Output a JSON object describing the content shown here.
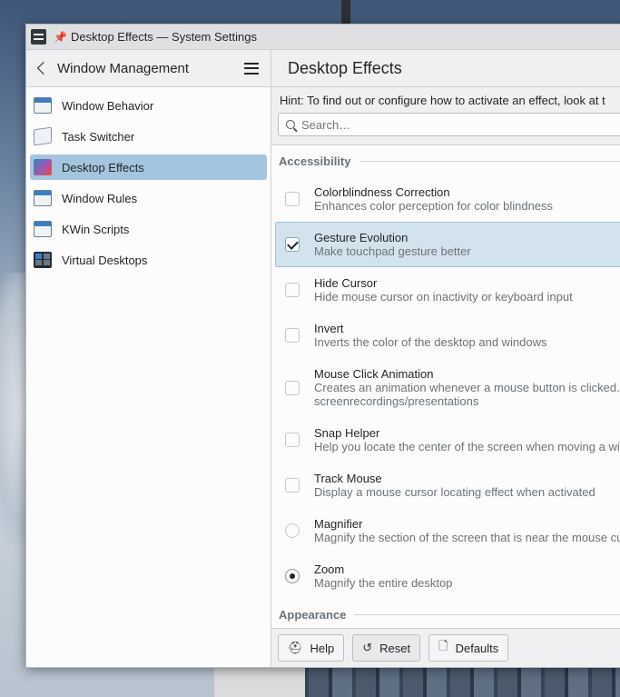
{
  "window": {
    "title": "Desktop Effects — System Settings"
  },
  "sidebar": {
    "header": "Window Management",
    "items": [
      {
        "label": "Window Behavior",
        "icon": "window-behavior-icon",
        "active": false
      },
      {
        "label": "Task Switcher",
        "icon": "task-switcher-icon",
        "active": false
      },
      {
        "label": "Desktop Effects",
        "icon": "desktop-effects-icon",
        "active": true
      },
      {
        "label": "Window Rules",
        "icon": "window-rules-icon",
        "active": false
      },
      {
        "label": "KWin Scripts",
        "icon": "kwin-scripts-icon",
        "active": false
      },
      {
        "label": "Virtual Desktops",
        "icon": "virtual-desktops-icon",
        "active": false
      }
    ]
  },
  "main": {
    "title": "Desktop Effects",
    "hint": "Hint: To find out or configure how to activate an effect, look at t",
    "search_placeholder": "Search…",
    "sections": [
      {
        "label": "Accessibility"
      },
      {
        "label": "Appearance"
      }
    ],
    "effects": [
      {
        "name": "Colorblindness Correction",
        "desc": "Enhances color perception for color blindness",
        "desc2": "",
        "control": "checkbox",
        "checked": false
      },
      {
        "name": "Gesture Evolution",
        "desc": "Make touchpad gesture better",
        "desc2": "",
        "control": "checkbox",
        "checked": true
      },
      {
        "name": "Hide Cursor",
        "desc": "Hide mouse cursor on inactivity or keyboard input",
        "desc2": "",
        "control": "checkbox",
        "checked": false
      },
      {
        "name": "Invert",
        "desc": "Inverts the color of the desktop and windows",
        "desc2": "",
        "control": "checkbox",
        "checked": false
      },
      {
        "name": "Mouse Click Animation",
        "desc": "Creates an animation whenever a mouse button is clicked. T",
        "desc2": "screenrecordings/presentations",
        "control": "checkbox",
        "checked": false
      },
      {
        "name": "Snap Helper",
        "desc": "Help you locate the center of the screen when moving a wi",
        "desc2": "",
        "control": "checkbox",
        "checked": false
      },
      {
        "name": "Track Mouse",
        "desc": "Display a mouse cursor locating effect when activated",
        "desc2": "",
        "control": "checkbox",
        "checked": false
      },
      {
        "name": "Magnifier",
        "desc": "Magnify the section of the screen that is near the mouse cu",
        "desc2": "",
        "control": "radio",
        "checked": false
      },
      {
        "name": "Zoom",
        "desc": "Magnify the entire desktop",
        "desc2": "",
        "control": "radio",
        "checked": true
      }
    ]
  },
  "footer": {
    "help_label": "Help",
    "reset_label": "Reset",
    "defaults_label": "Defaults"
  }
}
